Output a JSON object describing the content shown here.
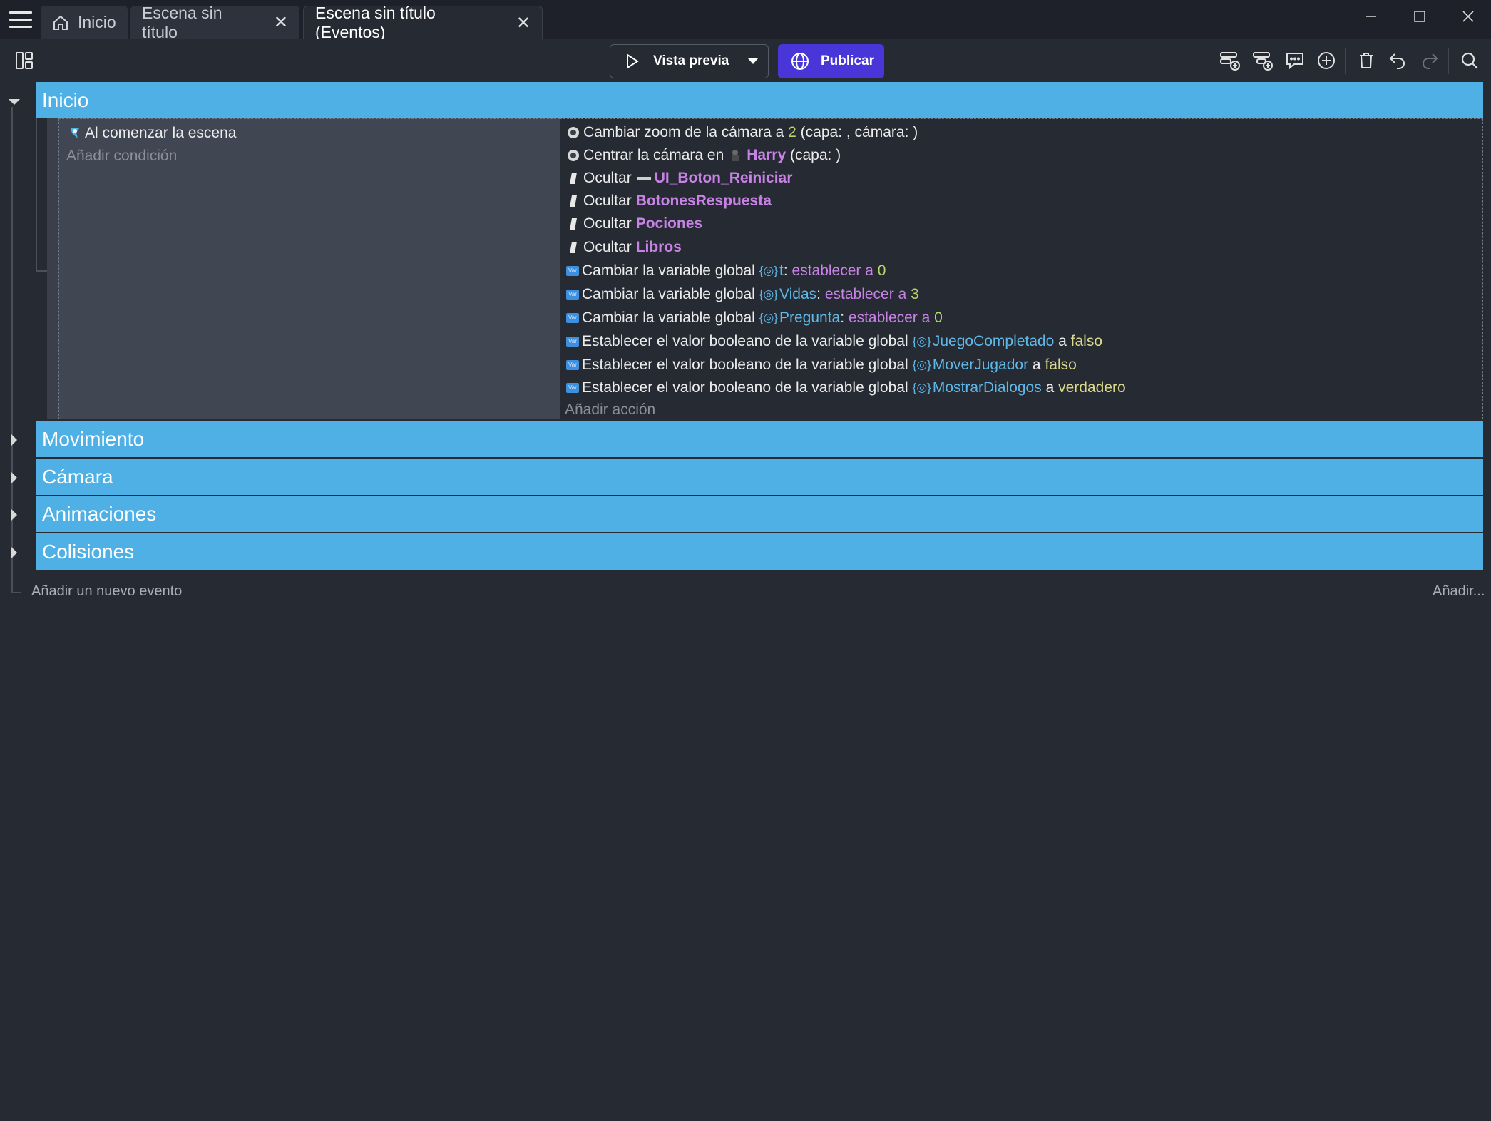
{
  "tabs": [
    {
      "label": "Inicio",
      "icon": "home-icon"
    },
    {
      "label": "Escena sin título"
    },
    {
      "label": "Escena sin título (Eventos)"
    }
  ],
  "toolbar": {
    "preview_label": "Vista previa",
    "publish_label": "Publicar"
  },
  "groups": {
    "inicio": "Inicio",
    "movimiento": "Movimiento",
    "camara": "Cámara",
    "animaciones": "Animaciones",
    "colisiones": "Colisiones"
  },
  "event": {
    "condition": "Al comenzar la escena",
    "add_condition": "Añadir condición",
    "add_action": "Añadir acción",
    "actions": {
      "a1_text": "Cambiar zoom de la cámara a",
      "a1_value": "2",
      "a1_suffix": "(capa: , cámara: )",
      "a2_text": "Centrar la cámara en",
      "a2_object": "Harry",
      "a2_suffix": "(capa: )",
      "hide_label": "Ocultar",
      "a3_object": "UI_Boton_Reiniciar",
      "a4_object": "BotonesRespuesta",
      "a5_object": "Pociones",
      "a6_object": "Libros",
      "var_label": "Cambiar la variable global",
      "a7_var": "t",
      "a8_var": "Vidas",
      "a9_var": "Pregunta",
      "set_op": "establecer a",
      "a7_value": "0",
      "a8_value": "3",
      "a9_value": "0",
      "bool_label": "Establecer el valor booleano de la variable global",
      "a10_var": "JuegoCompletado",
      "a11_var": "MoverJugador",
      "a12_var": "MostrarDialogos",
      "to": "a",
      "a10_value": "falso",
      "a11_value": "falso",
      "a12_value": "verdadero"
    }
  },
  "footer": {
    "add_event": "Añadir un nuevo evento",
    "add_more": "Añadir..."
  },
  "colors": {
    "group_header": "#4fb0e6",
    "publish": "#4936d9",
    "object": "#c882e6",
    "variable": "#5fb8e8"
  }
}
